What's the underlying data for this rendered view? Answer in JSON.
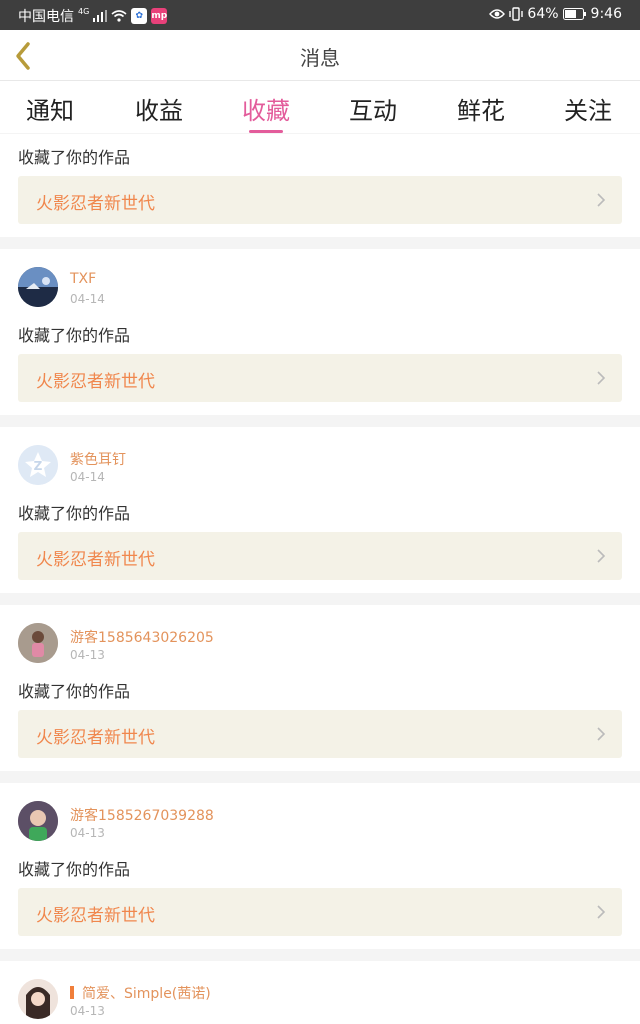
{
  "status_bar": {
    "carrier": "中国电信",
    "network": "4G",
    "battery": "64%",
    "time": "9:46",
    "icons": [
      "signal-icon",
      "wifi-icon",
      "app-icon",
      "app-icon",
      "eye-icon",
      "vibrate-icon",
      "battery-icon"
    ]
  },
  "header": {
    "title": "消息",
    "back_icon": "chevron-left-icon"
  },
  "tabs": [
    {
      "label": "通知",
      "active": false
    },
    {
      "label": "收益",
      "active": false
    },
    {
      "label": "收藏",
      "active": true
    },
    {
      "label": "互动",
      "active": false
    },
    {
      "label": "鲜花",
      "active": false
    },
    {
      "label": "关注",
      "active": false
    }
  ],
  "colors": {
    "accent": "#e35c9b",
    "username": "#e3935c",
    "work_title": "#f0874d",
    "work_bg": "#f4f2e7"
  },
  "messages": [
    {
      "username": "",
      "date": "",
      "action": "收藏了你的作品",
      "work_title": "火影忍者新世代"
    },
    {
      "username": "TXF",
      "date": "04-14",
      "action": "收藏了你的作品",
      "work_title": "火影忍者新世代"
    },
    {
      "username": "紫色耳钉",
      "date": "04-14",
      "action": "收藏了你的作品",
      "work_title": "火影忍者新世代"
    },
    {
      "username": "游客1585643026205",
      "date": "04-13",
      "action": "收藏了你的作品",
      "work_title": "火影忍者新世代"
    },
    {
      "username": "游客1585267039288",
      "date": "04-13",
      "action": "收藏了你的作品",
      "work_title": "火影忍者新世代"
    },
    {
      "username": "简爱、Simple(茜诺)",
      "date": "04-13"
    }
  ]
}
